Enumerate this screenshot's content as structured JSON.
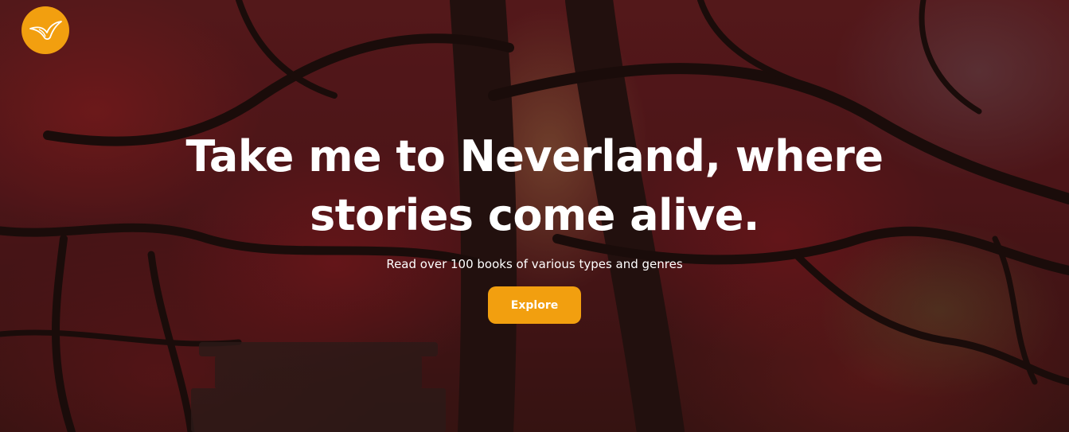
{
  "brand": {
    "logo_icon": "bird-icon",
    "accent_color": "#f29f0f"
  },
  "hero": {
    "background_icon": "red-maple-forest-photo",
    "headline": "Take me to Neverland, where stories come alive.",
    "subtitle": "Read over 100 books of various types and genres",
    "cta_label": "Explore"
  }
}
